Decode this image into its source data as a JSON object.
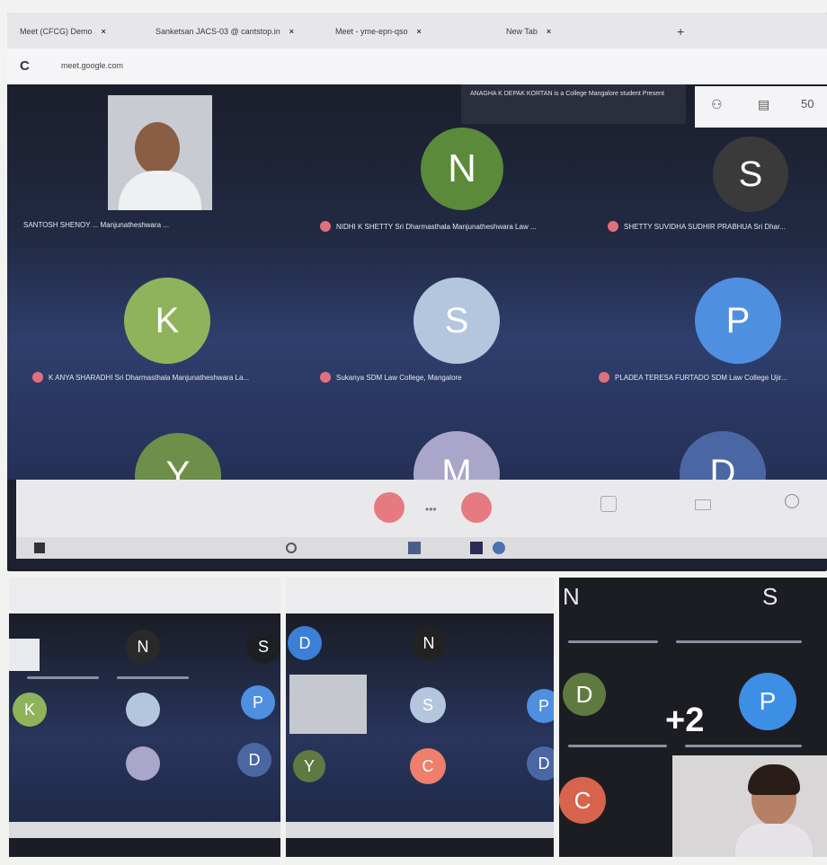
{
  "browser": {
    "tabs": [
      "Meet (CFCG) Demo",
      "Sanketsan JACS-03 @ cantstop.in",
      "Meet - yme-epn-qso",
      "New Tab"
    ],
    "url": "meet.google.com"
  },
  "meet": {
    "notice": "ANAGHA K DEPAK KORTAN is a College Mangalore student Present",
    "top_count": "50",
    "participants": [
      {
        "initial": "",
        "name": "SANTOSH SHENOY ... Manjunatheshwara ...",
        "color": "#6b6b6b"
      },
      {
        "initial": "N",
        "name": "NIDHI K SHETTY Sri Dharmasthala Manjunatheshwara Law ...",
        "color": "#5a8a3a"
      },
      {
        "initial": "S",
        "name": "SHETTY SUVIDHA SUDHIR PRABHUA Sri Dhar...",
        "color": "#3a3a3a"
      },
      {
        "initial": "K",
        "name": "K ANYA SHARADHI Sri Dharmasthala Manjunatheshwara La...",
        "color": "#8fb35a"
      },
      {
        "initial": "S",
        "name": "Sukanya SDM Law College, Mangalore",
        "color": "#b3c6de"
      },
      {
        "initial": "P",
        "name": "PLADEA TERESA FURTADO SDM Law College Ujir...",
        "color": "#4f8fe0"
      },
      {
        "initial": "Y",
        "name": "",
        "color": "#6d8f4a"
      },
      {
        "initial": "M",
        "name": "",
        "color": "#a9a6c9"
      },
      {
        "initial": "D",
        "name": "",
        "color": "#4b67a3"
      }
    ]
  },
  "panels": {
    "left": {
      "initials": [
        "N",
        "S",
        "K",
        "P",
        "D"
      ]
    },
    "middle": {
      "initials": [
        "D",
        "N",
        "S",
        "P",
        "Y",
        "C",
        "D"
      ]
    },
    "right": {
      "initials": [
        "N",
        "S",
        "D",
        "P",
        "C"
      ],
      "overflow": "+2"
    }
  }
}
